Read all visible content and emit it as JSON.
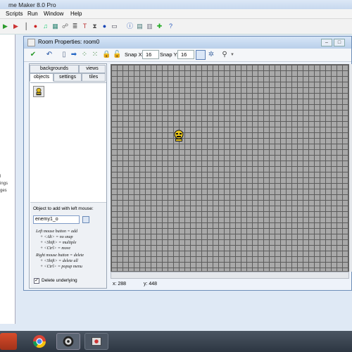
{
  "app": {
    "title": "me Maker 8.0 Pro"
  },
  "menu": {
    "items": [
      "Scripts",
      "Run",
      "Window",
      "Help"
    ]
  },
  "left_pane": {
    "items": [
      "l",
      "ings",
      "ges"
    ]
  },
  "room": {
    "title": "Room Properties: room0",
    "snap_x_label": "Snap X:",
    "snap_x_value": "16",
    "snap_y_label": "Snap Y:",
    "snap_y_value": "16",
    "tabs": {
      "backgrounds": "backgrounds",
      "views": "views",
      "objects": "objects",
      "settings": "settings",
      "tiles": "tiles"
    },
    "add_label": "Object to add with left mouse:",
    "object_value": "enemy1_o",
    "help_lines": [
      "Left mouse button = add",
      "+ <Alt> = no snap",
      "+ <Shift> = multiple",
      "+ <Ctrl> = move",
      "Right mouse button = delete",
      "+ <Shift> = delete all",
      "+ <Ctrl> = popup menu"
    ],
    "delete_underlying_label": "Delete underlying",
    "delete_underlying_checked": true,
    "status_x": "x: 288",
    "status_y": "y: 448"
  },
  "colors": {
    "grid_bg": "#a9a9a9",
    "grid_line": "#5c5c5c",
    "title_bar": "#c7d8ee"
  }
}
